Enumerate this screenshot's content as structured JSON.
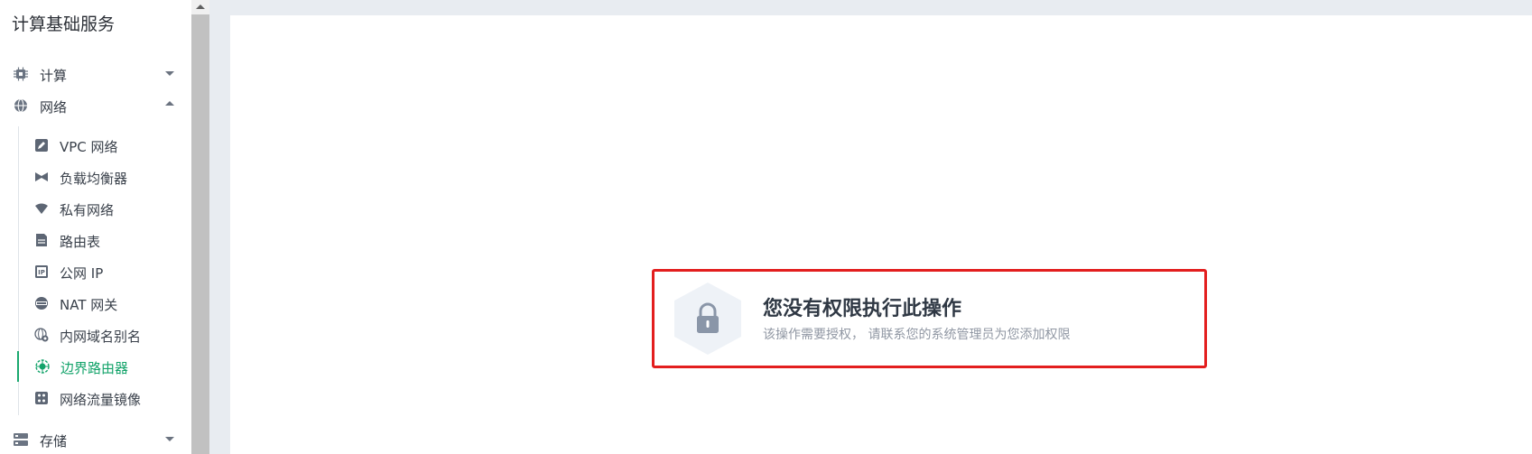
{
  "sidebar": {
    "title": "计算基础服务",
    "groups": {
      "compute": {
        "label": "计算",
        "icon": "cpu-icon",
        "expanded": false
      },
      "network": {
        "label": "网络",
        "icon": "globe-icon",
        "expanded": true
      },
      "storage": {
        "label": "存储",
        "icon": "storage-icon",
        "expanded": false
      }
    },
    "network_items": [
      {
        "label": "VPC 网络",
        "icon": "vpc-icon"
      },
      {
        "label": "负载均衡器",
        "icon": "load-balancer-icon"
      },
      {
        "label": "私有网络",
        "icon": "private-network-icon"
      },
      {
        "label": "路由表",
        "icon": "route-table-icon"
      },
      {
        "label": "公网 IP",
        "icon": "public-ip-icon"
      },
      {
        "label": "NAT 网关",
        "icon": "nat-gateway-icon"
      },
      {
        "label": "内网域名别名",
        "icon": "dns-alias-icon"
      },
      {
        "label": "边界路由器",
        "icon": "border-router-icon",
        "active": true
      },
      {
        "label": "网络流量镜像",
        "icon": "traffic-mirror-icon"
      }
    ]
  },
  "notice": {
    "icon": "lock-icon",
    "title": "您没有权限执行此操作",
    "description": "该操作需要授权， 请联系您的系统管理员为您添加权限"
  },
  "colors": {
    "accent": "#13a36a",
    "highlight_border": "#e31e1e",
    "background": "#e8ecf1"
  }
}
